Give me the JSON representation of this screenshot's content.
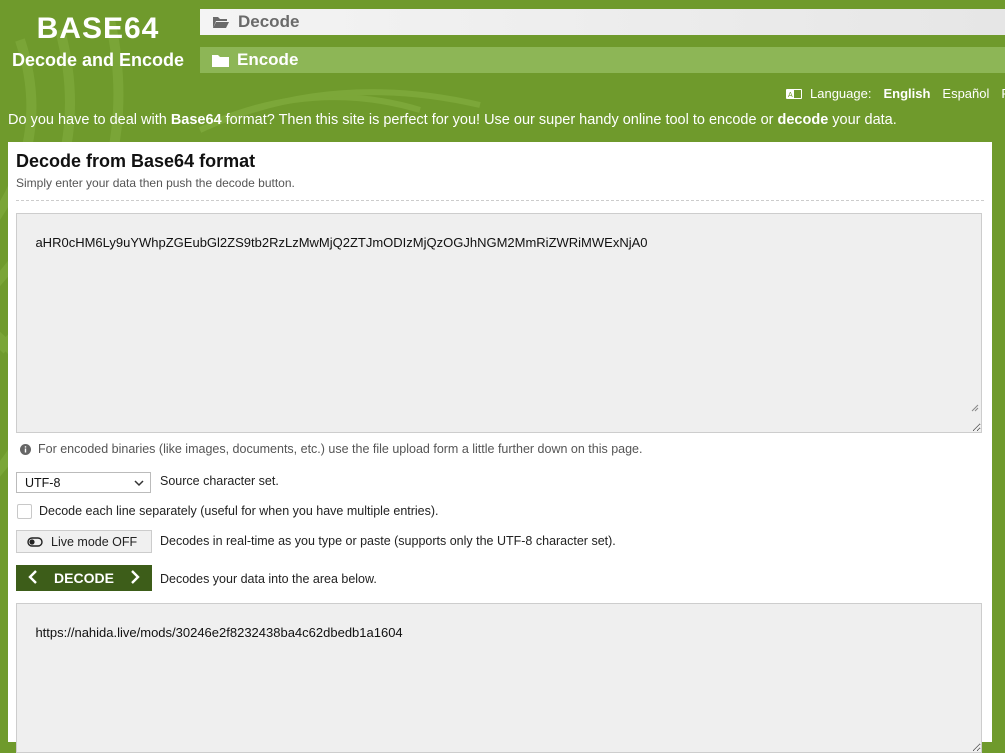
{
  "logo": {
    "title": "BASE64",
    "subtitle": "Decode and Encode"
  },
  "nav": {
    "decode_label": "Decode",
    "encode_label": "Encode"
  },
  "language": {
    "label": "Language:",
    "current": "English",
    "options": [
      "Español",
      "Po"
    ]
  },
  "intro": {
    "part1": "Do you have to deal with ",
    "bold1": "Base64",
    "part2": " format? Then this site is perfect for you! Use our super handy online tool to encode or ",
    "bold2": "decode",
    "part3": " your data."
  },
  "panel": {
    "title": "Decode from Base64 format",
    "subtitle": "Simply enter your data then push the decode button.",
    "input_value": "aHR0cHM6Ly9uYWhpZGEubGl2ZS9tb2RzLzMwMjQ2ZTJmODIzMjQzOGJhNGM2MmRiZWRiMWExNjA0",
    "note": "For encoded binaries (like images, documents, etc.) use the file upload form a little further down on this page.",
    "charset_value": "UTF-8",
    "charset_label": "Source character set.",
    "each_line_label": "Decode each line separately (useful for when you have multiple entries).",
    "live_mode_label": "Live mode OFF",
    "live_mode_desc": "Decodes in real-time as you type or paste (supports only the UTF-8 character set).",
    "decode_button": "DECODE",
    "decode_desc": "Decodes your data into the area below.",
    "output_value": "https://nahida.live/mods/30246e2f8232438ba4c62dbedb1a1604"
  },
  "colors": {
    "background": "#6f9a2c",
    "button": "#3d5d19",
    "nav_encode": "#8db656"
  }
}
